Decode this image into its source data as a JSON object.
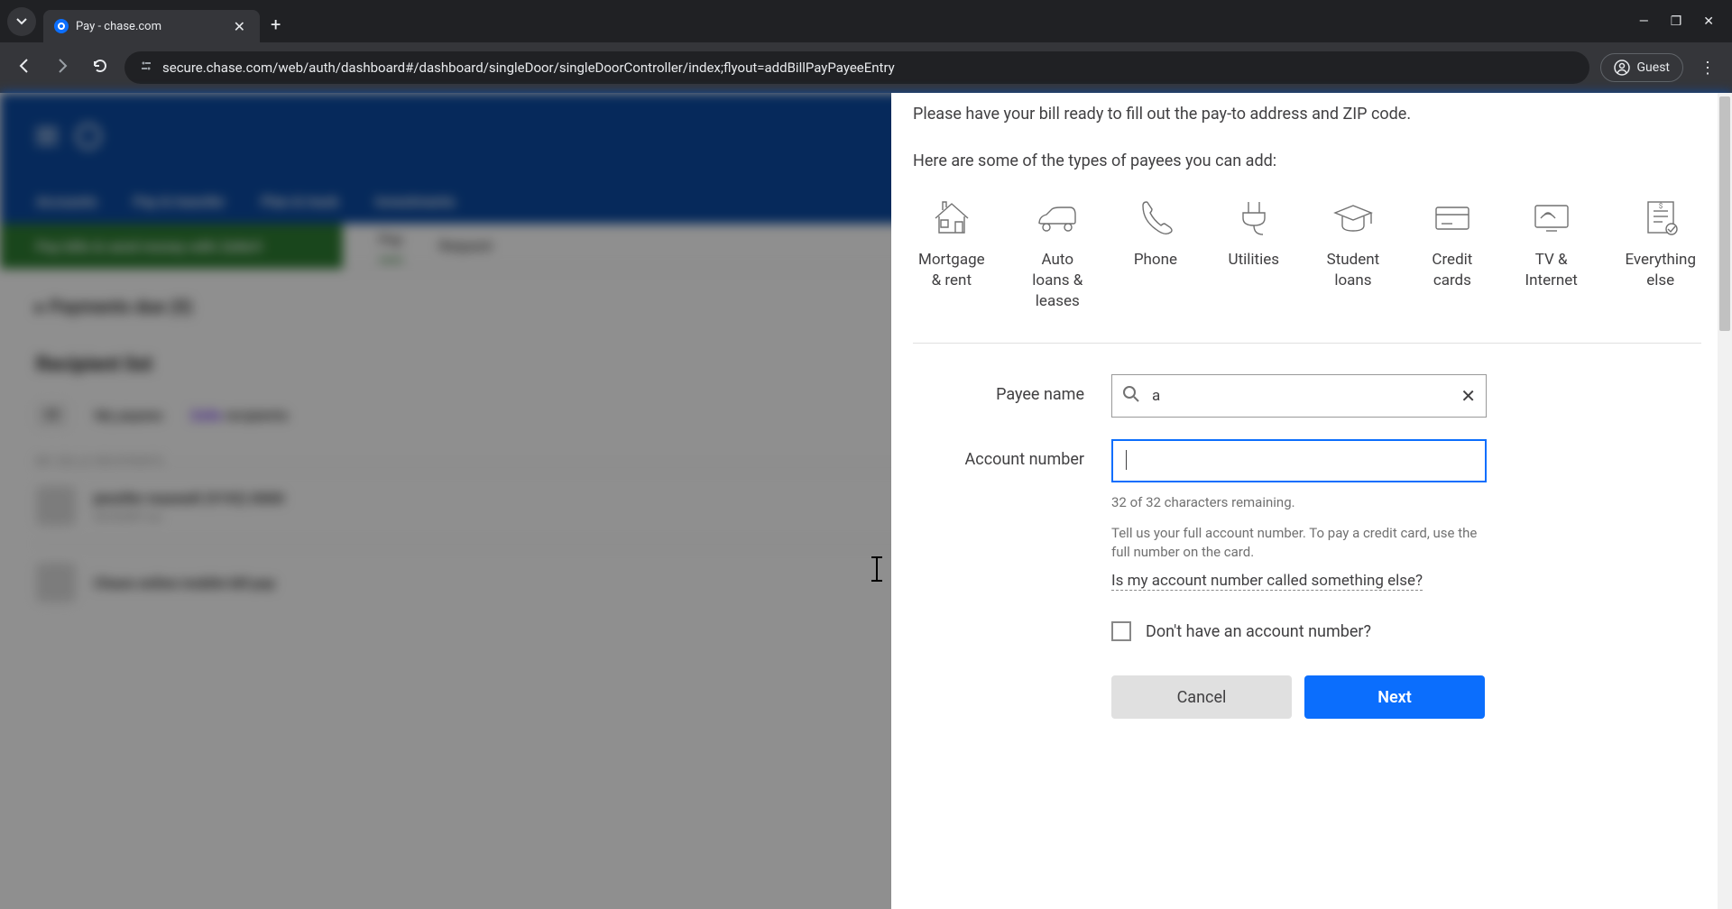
{
  "browser": {
    "tab_title": "Pay - chase.com",
    "url": "secure.chase.com/web/auth/dashboard#/dashboard/singleDoor/singleDoorController/index;flyout=addBillPayPayeeEntry",
    "guest_label": "Guest"
  },
  "background": {
    "nav_items": [
      "Accounts",
      "Pay & transfer",
      "Plan & track",
      "Investments"
    ],
    "green_banner": "Pay bills & send money with Zelle®",
    "tab_pay": "Pay",
    "tab_request": "Request",
    "payments_due": "Payments due (0)",
    "recipient_list": "Recipient list",
    "filter_all": "All",
    "filter_my": "My payees",
    "filter_zelle": "My Zelle recipients",
    "small_header": "MY ZELLE RECIPIENTS",
    "row1_name": "jennifer maxwell (9192) 0000",
    "row1_sub": "ACCOUNT xxx"
  },
  "flyout": {
    "intro1": "Please have your bill ready to fill out the pay-to address and ZIP code.",
    "intro2": "Here are some of the types of payees you can add:",
    "types": [
      {
        "label": "Mortgage\n& rent",
        "icon": "house"
      },
      {
        "label": "Auto\nloans &\nleases",
        "icon": "car"
      },
      {
        "label": "Phone",
        "icon": "phone"
      },
      {
        "label": "Utilities",
        "icon": "plug"
      },
      {
        "label": "Student\nloans",
        "icon": "grad"
      },
      {
        "label": "Credit\ncards",
        "icon": "card"
      },
      {
        "label": "TV &\nInternet",
        "icon": "tv"
      },
      {
        "label": "Everything\nelse",
        "icon": "doc"
      }
    ],
    "form": {
      "payee_name_label": "Payee name",
      "payee_name_value": "a",
      "account_number_label": "Account number",
      "account_number_value": "",
      "char_remaining": "32 of 32 characters remaining.",
      "account_helper": "Tell us your full account number. To pay a credit card, use the full number on the card.",
      "account_link": "Is my account number called something else?",
      "no_account_label": "Don't have an account number?",
      "cancel": "Cancel",
      "next": "Next"
    }
  }
}
